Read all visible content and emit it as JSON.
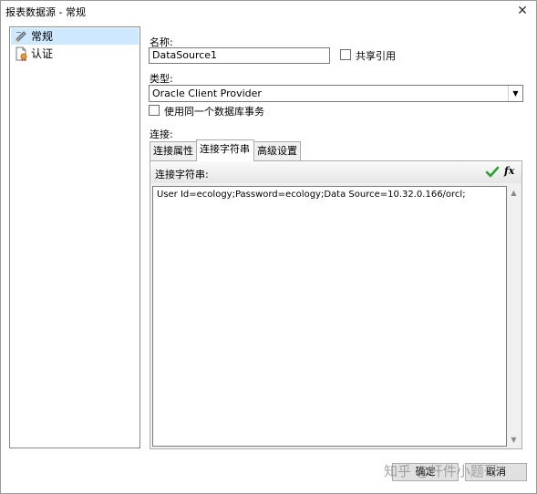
{
  "window": {
    "title": "报表数据源 - 常规",
    "close_glyph": "✕"
  },
  "sidebar": {
    "items": [
      {
        "label": "常规",
        "icon": "general-settings-icon",
        "selected": true
      },
      {
        "label": "认证",
        "icon": "certificate-document-icon",
        "selected": false
      }
    ]
  },
  "form": {
    "name_label": "名称:",
    "name_value": "DataSource1",
    "shared_ref_label": "共享引用",
    "type_label": "类型:",
    "type_value": "Oracle Client Provider",
    "same_transaction_label": "使用同一个数据库事务",
    "connection_label": "连接:"
  },
  "tabs": [
    {
      "label": "连接属性",
      "active": false
    },
    {
      "label": "连接字符串",
      "active": true
    },
    {
      "label": "高级设置",
      "active": false
    }
  ],
  "connection_string": {
    "label": "连接字符串:",
    "value": "User Id=ecology;Password=ecology;Data Source=10.32.0.166/orcl;",
    "fx_label": "fx"
  },
  "buttons": {
    "ok": "确定",
    "cancel": "取消"
  },
  "watermark": "知乎 @杆件小题哥",
  "colors": {
    "selection": "#cde8ff",
    "accept_check": "#2e9e2e"
  }
}
